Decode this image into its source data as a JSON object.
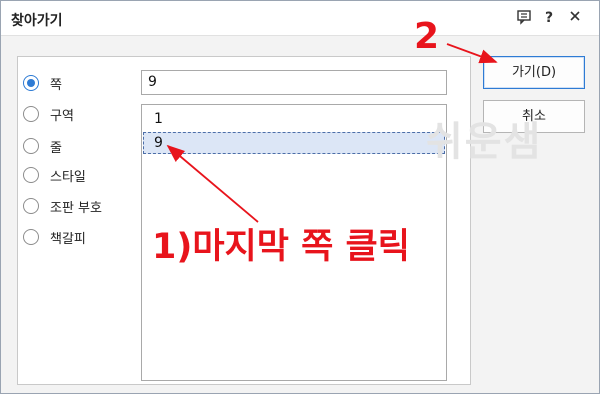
{
  "window": {
    "title": "찾아가기",
    "icons": [
      "comment-icon",
      "help-icon",
      "close-icon"
    ]
  },
  "targets": [
    {
      "label": "쪽",
      "checked": true
    },
    {
      "label": "구역",
      "checked": false
    },
    {
      "label": "줄",
      "checked": false
    },
    {
      "label": "스타일",
      "checked": false
    },
    {
      "label": "조판 부호",
      "checked": false
    },
    {
      "label": "책갈피",
      "checked": false
    }
  ],
  "page_input": {
    "value": "9"
  },
  "page_list": {
    "items": [
      "1",
      "9"
    ],
    "selected": "9"
  },
  "buttons": {
    "go": "가기(D)",
    "cancel": "취소"
  },
  "watermark": "쉬운샘",
  "annotations": {
    "step1": "1)마지막 쪽 클릭",
    "step2": "2"
  },
  "colors": {
    "accent": "#2e7bd4",
    "annotation": "#e8141c",
    "selection": "#dce6f6"
  }
}
